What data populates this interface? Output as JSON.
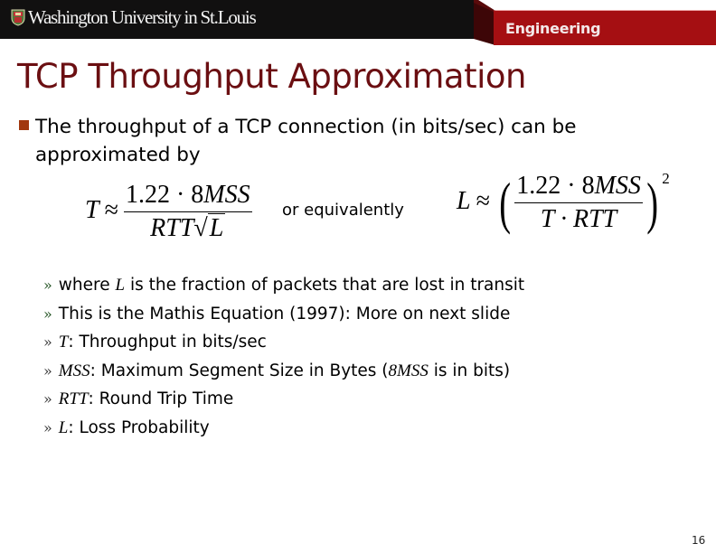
{
  "header": {
    "university": "Washington University in St.Louis",
    "school": "Engineering",
    "logo_icon": "university-shield-icon",
    "colors": {
      "black_bar": "#111010",
      "red_bar": "#a50f12",
      "title": "#6b0f12",
      "bullet": "#a1380f"
    }
  },
  "slide": {
    "title": "TCP Throughput Approximation",
    "bullet": "The throughput of a TCP connection (in bits/sec) can be approximated by",
    "formula1": {
      "lhs": "T",
      "approx": "≈",
      "numerator": "1.22 · 8",
      "numerator_var": "MSS",
      "denominator_var": "RTT",
      "sqrt_var": "L"
    },
    "connector": "or equivalently",
    "formula2": {
      "lhs": "L",
      "approx": "≈",
      "numerator": "1.22 · 8",
      "numerator_var": "MSS",
      "denominator": "T · RTT",
      "exponent": "2"
    },
    "subbullets": [
      {
        "pre": "where ",
        "var": "L",
        "post": " is the fraction of packets that are lost in transit"
      },
      {
        "pre": "This is the Mathis Equation (1997): More on next slide",
        "var": "",
        "post": ""
      },
      {
        "pre": "",
        "var": "T",
        "post": ": Throughput in bits/sec"
      },
      {
        "pre": "",
        "var": "MSS",
        "post": ": Maximum Segment Size in Bytes (",
        "var2": "8MSS",
        "post2": " is in bits)"
      },
      {
        "pre": "",
        "var": "RTT",
        "post": ": Round Trip Time"
      },
      {
        "pre": "",
        "var": "L",
        "post": ": Loss Probability"
      }
    ],
    "subbullet_marker": "»",
    "page_number": "16"
  }
}
